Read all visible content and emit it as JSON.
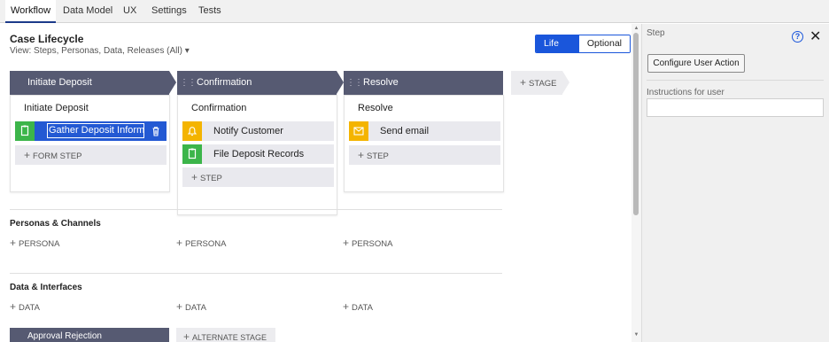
{
  "tabs": [
    {
      "label": "Workflow",
      "active": true
    },
    {
      "label": "Data Model",
      "active": false
    },
    {
      "label": "UX",
      "active": false
    },
    {
      "label": "Settings",
      "active": false
    },
    {
      "label": "Tests",
      "active": false
    }
  ],
  "header": {
    "title": "Case Lifecycle",
    "view": "View: Steps, Personas, Data, Releases (All)",
    "view_caret": "▾",
    "toggle": {
      "lifecycle": "Life cycle",
      "optional": "Optional"
    }
  },
  "stages": [
    {
      "name": "Initiate Deposit",
      "process": "Initiate Deposit",
      "accent": "#3cb54a",
      "steps": [
        {
          "label": "Gather Deposit Informa",
          "type": "form",
          "color": "#3cb54a",
          "selected": true
        }
      ],
      "add_label": "FORM STEP"
    },
    {
      "name": "Confirmation",
      "process": "Confirmation",
      "accent": "#565a72",
      "steps": [
        {
          "label": "Notify Customer",
          "type": "bell",
          "color": "#f4b400",
          "selected": false
        },
        {
          "label": "File Deposit Records",
          "type": "form",
          "color": "#3cb54a",
          "selected": false
        }
      ],
      "add_label": "STEP"
    },
    {
      "name": "Resolve",
      "process": "Resolve",
      "accent": "#d9302f",
      "steps": [
        {
          "label": "Send email",
          "type": "email",
          "color": "#f4b400",
          "selected": false
        }
      ],
      "add_label": "STEP"
    }
  ],
  "add_stage_label": "STAGE",
  "sections": {
    "personas": {
      "title": "Personas & Channels",
      "add": "PERSONA"
    },
    "data": {
      "title": "Data & Interfaces",
      "add": "DATA"
    }
  },
  "alternate": {
    "stage_name": "Approval Rejection",
    "add_label": "ALTERNATE STAGE"
  },
  "panel": {
    "title": "Step",
    "help": "?",
    "close": "✕",
    "configure_button": "Configure User Action",
    "instructions_label": "Instructions for user",
    "instructions_value": ""
  },
  "icons": {
    "plus": "+",
    "trash": "trash-icon",
    "drag": "drag-handle-icon"
  }
}
